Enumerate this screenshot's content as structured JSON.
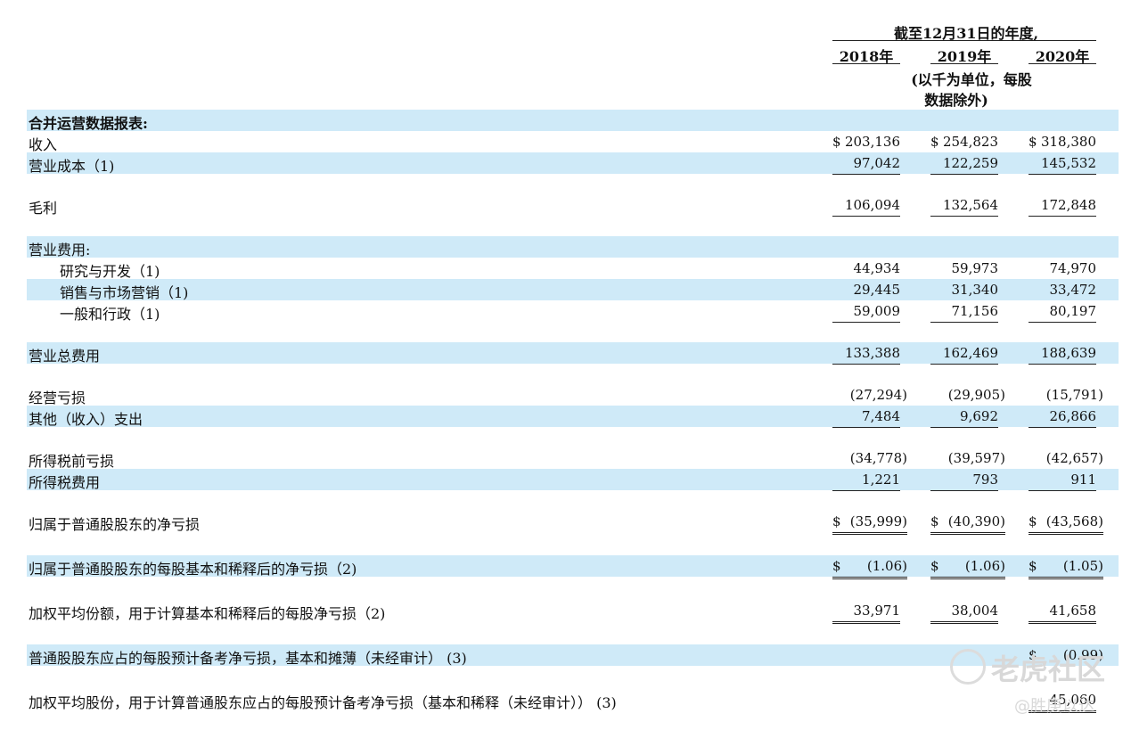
{
  "header": {
    "period": "截至12月31日的年度,",
    "years": [
      "2018年",
      "2019年",
      "2020年"
    ],
    "unit_line1": "(以千为单位，每股",
    "unit_line2": "数据除外)"
  },
  "rows": [
    {
      "label": "合并运营数据报表:"
    },
    {
      "label": "收入",
      "values": [
        "203,136",
        "254,823",
        "318,380"
      ]
    },
    {
      "label": "营业成本（1)",
      "values": [
        "97,042",
        "122,259",
        "145,532"
      ]
    },
    {
      "label": "毛利",
      "values": [
        "106,094",
        "132,564",
        "172,848"
      ]
    },
    {
      "label": "营业费用:"
    },
    {
      "label": "研究与开发（1)",
      "values": [
        "44,934",
        "59,973",
        "74,970"
      ]
    },
    {
      "label": "销售与市场营销（1)",
      "values": [
        "29,445",
        "31,340",
        "33,472"
      ]
    },
    {
      "label": "一般和行政（1)",
      "values": [
        "59,009",
        "71,156",
        "80,197"
      ]
    },
    {
      "label": "营业总费用",
      "values": [
        "133,388",
        "162,469",
        "188,639"
      ]
    },
    {
      "label": "经营亏损",
      "values": [
        "(27,294)",
        "(29,905)",
        "(15,791)"
      ]
    },
    {
      "label": "其他（收入）支出",
      "values": [
        "7,484",
        "9,692",
        "26,866"
      ]
    },
    {
      "label": "所得税前亏损",
      "values": [
        "(34,778)",
        "(39,597)",
        "(42,657)"
      ]
    },
    {
      "label": "所得税费用",
      "values": [
        "1,221",
        "793",
        "911"
      ]
    },
    {
      "label": "归属于普通股股东的净亏损",
      "values": [
        "(35,999)",
        "(40,390)",
        "(43,568)"
      ]
    },
    {
      "label": "归属于普通股股东的每股基本和稀释后的净亏损（2)",
      "values": [
        "(1.06)",
        "(1.06)",
        "(1.05)"
      ]
    },
    {
      "label": "加权平均份额，用于计算基本和稀释后的每股净亏损（2)",
      "values": [
        "33,971",
        "38,004",
        "41,658"
      ]
    },
    {
      "label": "普通股股东应占的每股预计备考净亏损，基本和摊薄（未经审计） (3)",
      "values": [
        "(0.99)"
      ]
    },
    {
      "label": "加权平均股份，用于计算普通股东应占的每股预计备考净亏损（基本和稀释（未经审计）） (3)",
      "values": [
        "45,060"
      ]
    }
  ],
  "currency_symbol": "$",
  "watermark": {
    "line1": "老虎社区",
    "line2": "@胜庚以达"
  },
  "colors": {
    "band": "#cfeaf8",
    "text": "#111111"
  }
}
